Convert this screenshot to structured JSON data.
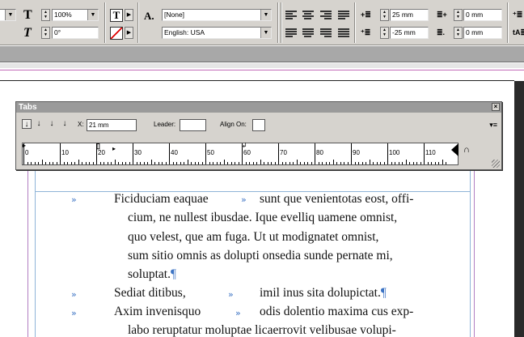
{
  "control_panel": {
    "scale": "100%",
    "skew": "0°",
    "char_style": "[None]",
    "language": "English: USA",
    "left_indent": "25 mm",
    "first_line_indent": "-25 mm",
    "right_indent": "0 mm",
    "last_line_indent": "0 mm"
  },
  "tabs_palette": {
    "title": "Tabs",
    "x_label": "X:",
    "x_value": "21 mm",
    "leader_label": "Leader:",
    "leader_value": "",
    "align_on_label": "Align On:",
    "align_on_value": "",
    "ruler_labels": [
      "0",
      "10",
      "20",
      "30",
      "40",
      "50",
      "60",
      "70",
      "80",
      "90",
      "100",
      "110"
    ]
  },
  "document": {
    "lines": [
      "Ficiduciam eaquae",
      "sunt que venientotas eost, offi-",
      "cium, ne nullest ibusdae. Ique evelliq uamene omnist,",
      "quo velest, que am fuga. Ut ut modignatet omnist,",
      "sum sitio omnis as dolupti onsedia sunde pernate mi,",
      "soluptat.",
      "Sediat ditibus,",
      "imil inus sita dolupictat.",
      "Axim invenisquo",
      "odis dolentio maxima cus exp-",
      "labo reruptatur moluptae licaerrovit velibusae volupi-"
    ],
    "tab_glyph": "»",
    "pilcrow": "¶"
  },
  "colors": {
    "panel_bg": "#d6d3ce",
    "tab_marker": "#3d74c4",
    "frame_guide": "#b27fc2"
  }
}
